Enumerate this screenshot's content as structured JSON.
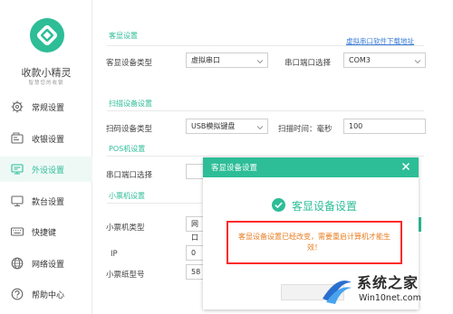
{
  "app": {
    "name": "收款小精灵",
    "slogan": "智慧您的收银"
  },
  "sidebar": {
    "items": [
      {
        "label": "常规设置",
        "icon": "gear-icon"
      },
      {
        "label": "收银设置",
        "icon": "cash-icon"
      },
      {
        "label": "外设设置",
        "icon": "peripheral-icon"
      },
      {
        "label": "款台设置",
        "icon": "monitor-icon"
      },
      {
        "label": "快捷键",
        "icon": "keyboard-icon"
      },
      {
        "label": "网络设置",
        "icon": "globe-icon"
      },
      {
        "label": "帮助中心",
        "icon": "help-icon"
      }
    ],
    "active_index": 2
  },
  "main": {
    "customer_display": {
      "section_title": "客显设置",
      "download_link": "虚拟串口软件下载地址",
      "type_label": "客显设备类型",
      "type_value": "虚拟串口",
      "port_label": "串口端口选择",
      "port_value": "COM3"
    },
    "scanner": {
      "section_title": "扫描设备设置",
      "type_label": "扫码设备类型",
      "type_value": "USB模拟键盘",
      "time_label": "扫描时间：毫秒",
      "time_value": "100"
    },
    "pos": {
      "section_title": "POS机设置",
      "port_label": "串口端口选择"
    },
    "printer": {
      "section_title": "小票机设置",
      "type_label": "小票机类型",
      "type_value": "网口",
      "ip_label": "IP",
      "ip_value": "0",
      "paper_label": "小票纸型号",
      "paper_value": "58"
    }
  },
  "dialog": {
    "title": "客显设备设置",
    "heading": "客显设备设置",
    "message": "客显设备设置已经改变，需要重启计算机才能生效！",
    "close_icon": "close-icon",
    "check_icon": "check-circle-icon"
  },
  "watermark": {
    "line1": "系统之家",
    "line2": "Win10net.com"
  },
  "colors": {
    "accent": "#2dbd97",
    "alert_border": "#ff2b2b",
    "alert_text": "#e77c1f",
    "link": "#3b7dd8"
  }
}
